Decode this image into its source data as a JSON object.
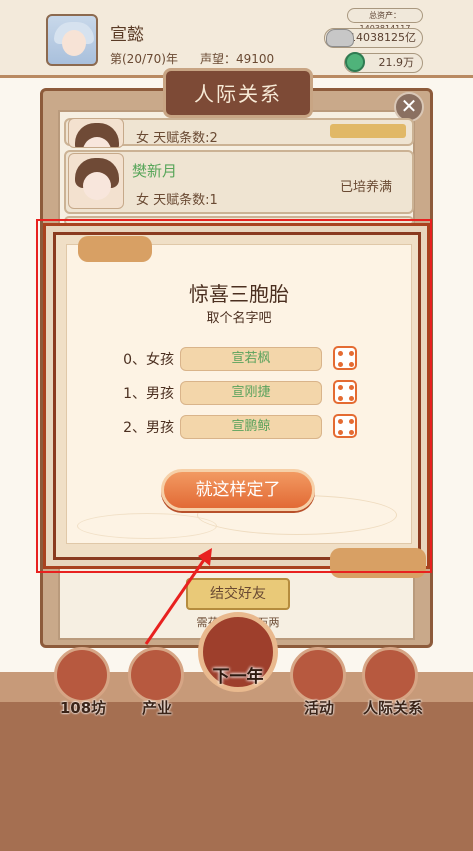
{
  "header": {
    "player_name": "宣懿",
    "year_text": "第(20/70)年",
    "fame_text": "声望：49100",
    "total_assets_text": "总资产：1403814117",
    "silver_text": "14038125亿",
    "jade_text": "21.9万"
  },
  "relations_panel": {
    "title": "人际关系",
    "close_icon": "close-icon",
    "members": [
      {
        "name": "",
        "info": "女  天赋条数:2"
      },
      {
        "name": "樊新月",
        "info": "女  天赋条数:1",
        "status": "已培养满"
      }
    ],
    "make_friend_label": "结交好友",
    "cost_text": "需花费4723万两"
  },
  "dialog": {
    "title": "惊喜三胞胎",
    "subtitle": "取个名字吧",
    "children": [
      {
        "label": "0、女孩",
        "name": "宣若枫",
        "dice_icon": "dice-icon"
      },
      {
        "label": "1、男孩",
        "name": "宣刚捷",
        "dice_icon": "dice-icon"
      },
      {
        "label": "2、男孩",
        "name": "宣鹏鲸",
        "dice_icon": "dice-icon"
      }
    ],
    "confirm_label": "就这样定了"
  },
  "bottom_nav": {
    "items": [
      {
        "label": "108坊",
        "icon": "pavilion-icon"
      },
      {
        "label": "产业",
        "icon": "shop-icon"
      },
      {
        "label": "下一年",
        "icon": "next-year-icon"
      },
      {
        "label": "活动",
        "icon": "scroll-icon"
      },
      {
        "label": "人际关系",
        "icon": "handshake-icon"
      }
    ]
  },
  "colors": {
    "highlight_box": "#e8211f",
    "confirm_button": "#e26a35",
    "name_green": "#5aa25c"
  }
}
